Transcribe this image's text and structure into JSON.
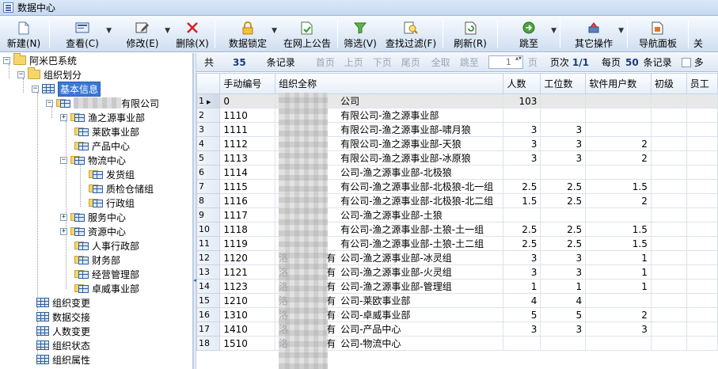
{
  "window": {
    "title": "数据中心"
  },
  "toolbar": {
    "buttons": [
      {
        "label": "新建(N)",
        "icon": "new-doc-icon"
      },
      {
        "label": "查看(C)",
        "icon": "view-icon",
        "dropdown": true
      },
      {
        "label": "修改(E)",
        "icon": "edit-icon",
        "dropdown": true
      },
      {
        "label": "删除(X)",
        "icon": "delete-icon"
      },
      {
        "label": "数据锁定",
        "icon": "lock-icon",
        "dropdown": true
      },
      {
        "label": "在网上公告",
        "icon": "publish-icon"
      },
      {
        "label": "筛选(V)",
        "icon": "filter-icon"
      },
      {
        "label": "查找过滤(F)",
        "icon": "find-filter-icon"
      },
      {
        "label": "刷新(R)",
        "icon": "refresh-icon"
      },
      {
        "label": "跳至",
        "icon": "goto-icon",
        "dropdown": true
      },
      {
        "label": "其它操作",
        "icon": "other-ops-icon",
        "dropdown": true
      },
      {
        "label": "导航面板",
        "icon": "nav-panel-icon"
      },
      {
        "label": "关",
        "icon": "close-icon"
      }
    ]
  },
  "tree": {
    "root": "阿米巴系统",
    "org_plan": "组织划分",
    "basic_info": "基本信息",
    "company_suffix": "有限公司",
    "depts": [
      "渔之源事业部",
      "莱欧事业部",
      "产品中心",
      "物流中心",
      "发货组",
      "质检仓储组",
      "行政组",
      "服务中心",
      "资源中心",
      "人事行政部",
      "财务部",
      "经营管理部",
      "卓威事业部"
    ],
    "bottom_items": [
      "组织变更",
      "数据交接",
      "人数变更",
      "组织状态",
      "组织属性"
    ]
  },
  "navbar": {
    "total_label": "共",
    "total": "35",
    "records_label": "条记录",
    "first": "首页",
    "prev": "上页",
    "next": "下页",
    "last": "尾页",
    "all": "全取",
    "jump": "跳至",
    "page_value": "1",
    "page_unit": "页",
    "page_info_label": "页次",
    "page_info": "1/1",
    "per_page_label": "每页",
    "per_page": "50",
    "per_page_unit": "条记录",
    "multi": "多"
  },
  "table": {
    "columns": [
      "手动编号",
      "组织全称",
      "人数",
      "工位数",
      "软件用户数",
      "初级",
      "员工"
    ],
    "rows": [
      {
        "idx": "1",
        "code": "0",
        "name": "公司",
        "people": "103",
        "seats": "",
        "users": ""
      },
      {
        "idx": "2",
        "code": "1110",
        "name": "有限公司-渔之源事业部",
        "people": "",
        "seats": "",
        "users": ""
      },
      {
        "idx": "3",
        "code": "1111",
        "name": "有限公司-渔之源事业部-啸月狼",
        "people": "3",
        "seats": "3",
        "users": ""
      },
      {
        "idx": "4",
        "code": "1112",
        "name": "有限公司-渔之源事业部-天狼",
        "people": "3",
        "seats": "3",
        "users": "2"
      },
      {
        "idx": "5",
        "code": "1113",
        "name": "有限公司-渔之源事业部-冰原狼",
        "people": "3",
        "seats": "3",
        "users": "2"
      },
      {
        "idx": "6",
        "code": "1114",
        "name": "公司-渔之源事业部-北极狼",
        "people": "",
        "seats": "",
        "users": ""
      },
      {
        "idx": "7",
        "code": "1115",
        "name": "有公司-渔之源事业部-北极狼-北一组",
        "people": "2.5",
        "seats": "2.5",
        "users": "1.5"
      },
      {
        "idx": "8",
        "code": "1116",
        "name": "有公司-渔之源事业部-北极狼-北二组",
        "people": "1.5",
        "seats": "2.5",
        "users": "2"
      },
      {
        "idx": "9",
        "code": "1117",
        "name": "公司-渔之源事业部-土狼",
        "people": "",
        "seats": "",
        "users": ""
      },
      {
        "idx": "10",
        "code": "1118",
        "name": "有公司-渔之源事业部-土狼-土一组",
        "people": "2.5",
        "seats": "2.5",
        "users": "1.5"
      },
      {
        "idx": "11",
        "code": "1119",
        "name": "有公司-渔之源事业部-土狼-土二组",
        "people": "2.5",
        "seats": "2.5",
        "users": "1.5"
      },
      {
        "idx": "12",
        "code": "1120",
        "name": "公司-渔之源事业部-冰灵组",
        "people": "3",
        "seats": "3",
        "users": "1"
      },
      {
        "idx": "13",
        "code": "1121",
        "name": "公司-渔之源事业部-火灵组",
        "people": "3",
        "seats": "3",
        "users": "1"
      },
      {
        "idx": "14",
        "code": "1123",
        "name": "公司-渔之源事业部-管理组",
        "people": "1",
        "seats": "1",
        "users": "1"
      },
      {
        "idx": "15",
        "code": "1210",
        "name": "公司-莱欧事业部",
        "people": "4",
        "seats": "4",
        "users": ""
      },
      {
        "idx": "16",
        "code": "1310",
        "name": "公司-卓威事业部",
        "people": "5",
        "seats": "5",
        "users": "2"
      },
      {
        "idx": "17",
        "code": "1410",
        "name": "公司-产品中心",
        "people": "3",
        "seats": "3",
        "users": "3"
      },
      {
        "idx": "18",
        "code": "1510",
        "name": "公司-物流中心",
        "people": "",
        "seats": "",
        "users": ""
      }
    ],
    "row_prefix_visible": [
      "",
      "",
      "",
      "",
      "",
      "",
      "",
      "",
      "",
      "",
      "",
      "洛",
      "洛",
      "洛",
      "洛",
      "洛",
      "洛",
      "洛"
    ],
    "row_prefix_2": [
      "",
      "",
      "",
      "",
      "",
      "",
      "",
      "",
      "",
      "",
      "",
      "有",
      "有",
      "有",
      "有",
      "有",
      "有",
      "有"
    ]
  },
  "colors": {
    "selection": "#3a78d6",
    "header_bg": "#e6eef8",
    "toolbar_bg": "#dfeaf7"
  }
}
